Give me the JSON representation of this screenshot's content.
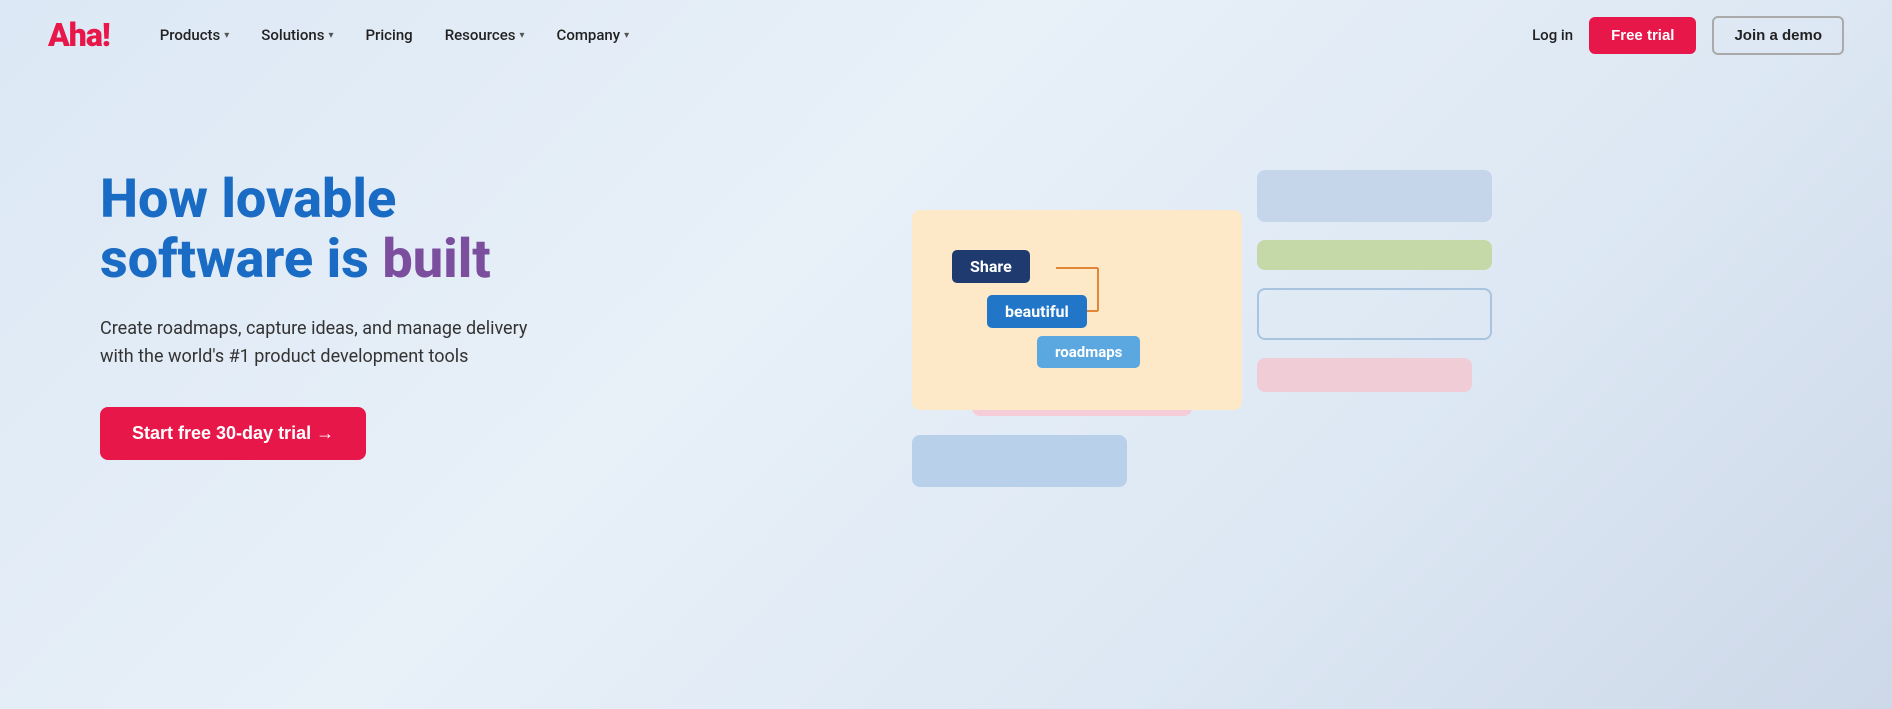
{
  "logo": {
    "text_aha": "Aha",
    "text_exclaim": "!"
  },
  "nav": {
    "items": [
      {
        "label": "Products",
        "has_dropdown": true
      },
      {
        "label": "Solutions",
        "has_dropdown": true
      },
      {
        "label": "Pricing",
        "has_dropdown": false
      },
      {
        "label": "Resources",
        "has_dropdown": true
      },
      {
        "label": "Company",
        "has_dropdown": true
      }
    ],
    "login_label": "Log in",
    "free_trial_label": "Free trial",
    "join_demo_label": "Join a demo"
  },
  "hero": {
    "headline_line1": "How lovable",
    "headline_line2": "software is built",
    "subtext": "Create roadmaps, capture ideas, and manage delivery with the world's #1 product development tools",
    "cta_label": "Start free 30-day trial →"
  },
  "illustration": {
    "node_share": "Share",
    "node_beautiful": "beautiful",
    "node_roadmaps": "roadmaps"
  }
}
